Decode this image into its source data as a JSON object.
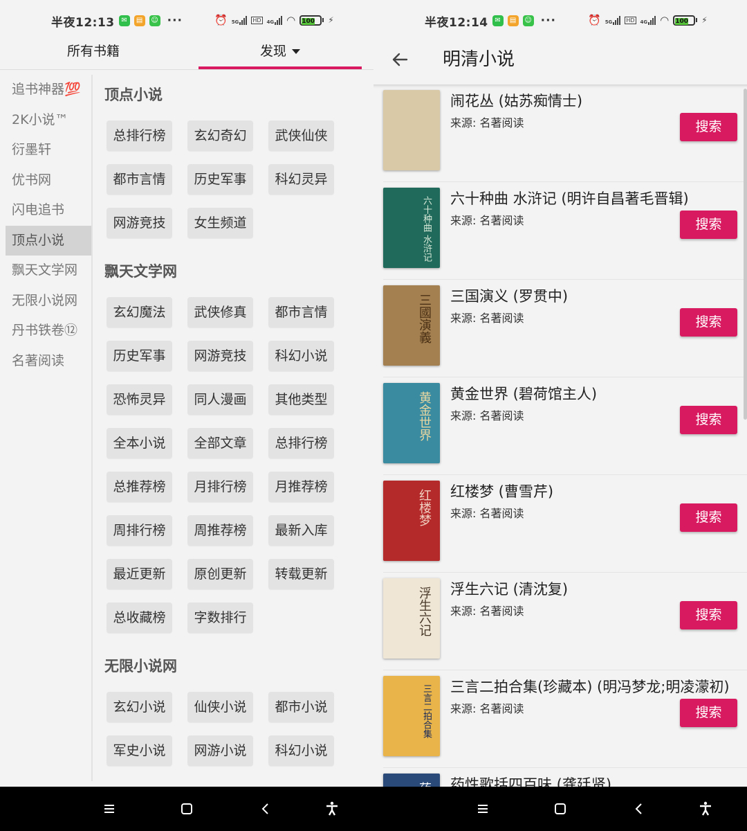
{
  "status_left": {
    "time": "半夜12:13",
    "battery": "100"
  },
  "status_right": {
    "time": "半夜12:14",
    "battery": "100"
  },
  "left": {
    "tabs": [
      {
        "label": "所有书籍"
      },
      {
        "label": "发现"
      }
    ],
    "sidebar": [
      {
        "label": "追书神器💯"
      },
      {
        "label": "2K小说™"
      },
      {
        "label": "衍墨轩"
      },
      {
        "label": "优书网"
      },
      {
        "label": "闪电追书"
      },
      {
        "label": "顶点小说"
      },
      {
        "label": "飘天文学网"
      },
      {
        "label": "无限小说网"
      },
      {
        "label": "丹书铁卷⑫"
      },
      {
        "label": "名著阅读"
      }
    ],
    "sections": [
      {
        "title": "顶点小说",
        "chips": [
          "总排行榜",
          "玄幻奇幻",
          "武侠仙侠",
          "都市言情",
          "历史军事",
          "科幻灵异",
          "网游竞技",
          "女生频道"
        ]
      },
      {
        "title": "飘天文学网",
        "chips": [
          "玄幻魔法",
          "武侠修真",
          "都市言情",
          "历史军事",
          "网游竞技",
          "科幻小说",
          "恐怖灵异",
          "同人漫画",
          "其他类型",
          "全本小说",
          "全部文章",
          "总排行榜",
          "总推荐榜",
          "月排行榜",
          "月推荐榜",
          "周排行榜",
          "周推荐榜",
          "最新入库",
          "最近更新",
          "原创更新",
          "转载更新",
          "总收藏榜",
          "字数排行"
        ]
      },
      {
        "title": "无限小说网",
        "chips": [
          "玄幻小说",
          "仙侠小说",
          "都市小说",
          "军史小说",
          "网游小说",
          "科幻小说"
        ]
      }
    ]
  },
  "right": {
    "title": "明清小说",
    "search_label": "搜索",
    "books": [
      {
        "title": "闹花丛 (姑苏痴情士)",
        "source": "来源: 名著阅读",
        "cover_bg": "#d9c9a6",
        "cover_fg": "#7a5a3a",
        "cover_text": ""
      },
      {
        "title": "六十种曲 水浒记 (明许自昌著毛晋辑)",
        "source": "来源: 名著阅读",
        "cover_bg": "#1f6a5a",
        "cover_fg": "#d7e8d8",
        "cover_text": "六十种曲 水浒记"
      },
      {
        "title": "三国演义 (罗贯中)",
        "source": "来源: 名著阅读",
        "cover_bg": "#a48050",
        "cover_fg": "#4a3015",
        "cover_text": "三國演義"
      },
      {
        "title": "黄金世界 (碧荷馆主人)",
        "source": "来源: 名著阅读",
        "cover_bg": "#3a8aa0",
        "cover_fg": "#e8d7a0",
        "cover_text": "黄金世界"
      },
      {
        "title": "红楼梦 (曹雪芹)",
        "source": "来源: 名著阅读",
        "cover_bg": "#b42a2a",
        "cover_fg": "#f0d0c0",
        "cover_text": "红楼梦"
      },
      {
        "title": "浮生六记 (清沈复)",
        "source": "来源: 名著阅读",
        "cover_bg": "#efe6d6",
        "cover_fg": "#4a3a2a",
        "cover_text": "浮生六记"
      },
      {
        "title": "三言二拍合集(珍藏本) (明冯梦龙;明凌濛初)",
        "source": "来源: 名著阅读",
        "cover_bg": "#e9b54a",
        "cover_fg": "#1a2a5a",
        "cover_text": "三言二拍合集"
      },
      {
        "title": "药性歌括四百味 (龚廷贤)",
        "source": "",
        "cover_bg": "#2a4a7a",
        "cover_fg": "#ffffff",
        "cover_text": "药"
      }
    ]
  }
}
